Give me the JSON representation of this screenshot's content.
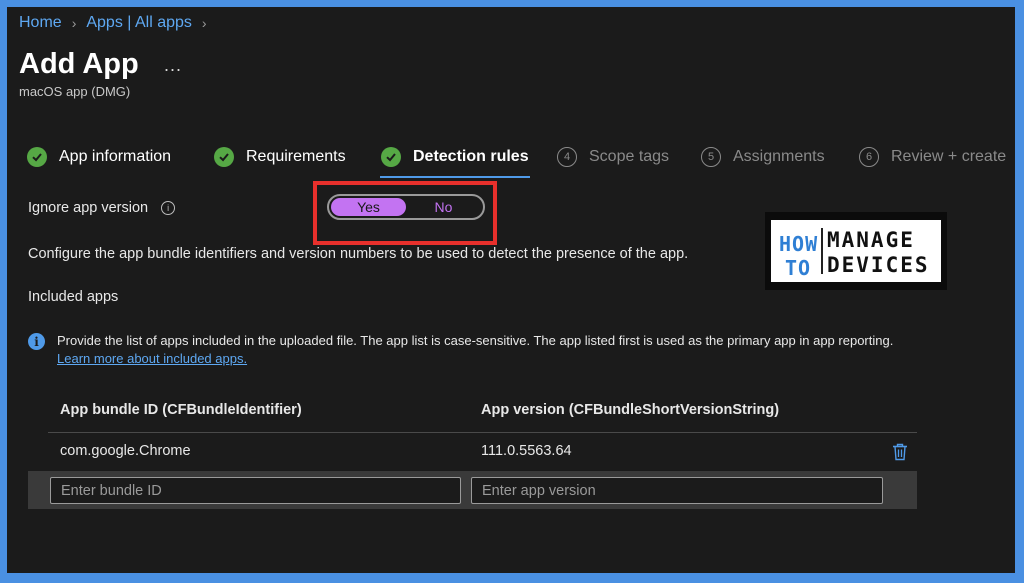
{
  "breadcrumb": {
    "items": [
      "Home",
      "Apps | All apps"
    ]
  },
  "page": {
    "title": "Add App",
    "more_label": "...",
    "subtitle": "macOS app (DMG)"
  },
  "steps": [
    {
      "label": "App information",
      "state": "done"
    },
    {
      "label": "Requirements",
      "state": "done"
    },
    {
      "label": "Detection rules",
      "state": "active"
    },
    {
      "label": "Scope tags",
      "state": "todo",
      "number": "4"
    },
    {
      "label": "Assignments",
      "state": "todo",
      "number": "5"
    },
    {
      "label": "Review + create",
      "state": "todo",
      "number": "6"
    }
  ],
  "ignore_version": {
    "label": "Ignore app version",
    "info": "i",
    "yes": "Yes",
    "no": "No",
    "selected": "Yes"
  },
  "config_text": "Configure the app bundle identifiers and version numbers to be used to detect the presence of the app.",
  "included_label": "Included apps",
  "info_banner": {
    "badge": "i",
    "text": "Provide the list of apps included in the uploaded file. The app list is case-sensitive. The app listed first is used as the primary app in app reporting.",
    "link": " Learn more about included apps."
  },
  "table": {
    "headers": [
      "App bundle ID (CFBundleIdentifier)",
      "App version (CFBundleShortVersionString)"
    ],
    "rows": [
      {
        "bundle_id": "com.google.Chrome",
        "version": "111.0.5563.64"
      }
    ],
    "bundle_placeholder": "Enter bundle ID",
    "version_placeholder": "Enter app version"
  },
  "logo": {
    "how": "HOW",
    "to": "TO",
    "manage": "MANAGE",
    "devices": "DEVICES"
  },
  "colors": {
    "accent": "#4f9ae8",
    "toggle": "#c373f2",
    "check": "#56a845",
    "highlight": "#e8302c"
  }
}
